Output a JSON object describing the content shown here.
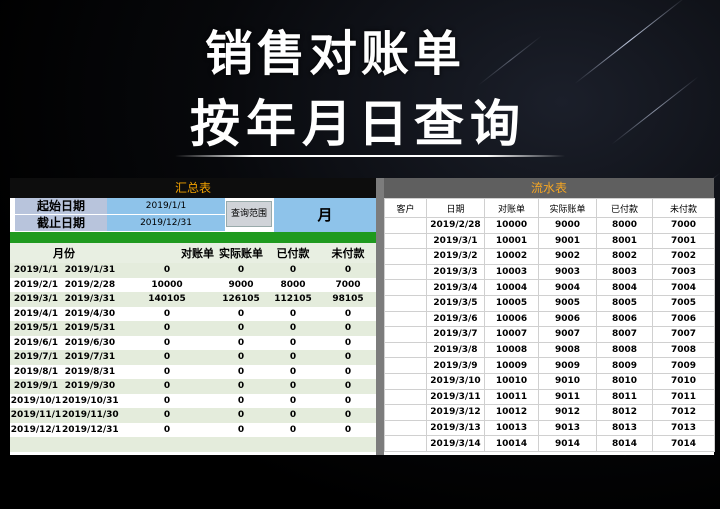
{
  "banner": {
    "title_line1": "销售对账单",
    "title_line2": "按年月日查询"
  },
  "summary": {
    "title": "汇总表",
    "start_label": "起始日期",
    "start_value": "2019/1/1",
    "end_label": "截止日期",
    "end_value": "2019/12/31",
    "query_button": "查询范围",
    "range_value": "月",
    "columns": [
      "月份",
      "对账单",
      "实际账单",
      "已付款",
      "未付款"
    ],
    "rows": [
      [
        "2019/1/1",
        "2019/1/31",
        "0",
        "0",
        "0",
        "0"
      ],
      [
        "2019/2/1",
        "2019/2/28",
        "10000",
        "9000",
        "8000",
        "7000"
      ],
      [
        "2019/3/1",
        "2019/3/31",
        "140105",
        "126105",
        "112105",
        "98105"
      ],
      [
        "2019/4/1",
        "2019/4/30",
        "0",
        "0",
        "0",
        "0"
      ],
      [
        "2019/5/1",
        "2019/5/31",
        "0",
        "0",
        "0",
        "0"
      ],
      [
        "2019/6/1",
        "2019/6/30",
        "0",
        "0",
        "0",
        "0"
      ],
      [
        "2019/7/1",
        "2019/7/31",
        "0",
        "0",
        "0",
        "0"
      ],
      [
        "2019/8/1",
        "2019/8/31",
        "0",
        "0",
        "0",
        "0"
      ],
      [
        "2019/9/1",
        "2019/9/30",
        "0",
        "0",
        "0",
        "0"
      ],
      [
        "2019/10/1",
        "2019/10/31",
        "0",
        "0",
        "0",
        "0"
      ],
      [
        "2019/11/1",
        "2019/11/30",
        "0",
        "0",
        "0",
        "0"
      ],
      [
        "2019/12/1",
        "2019/12/31",
        "0",
        "0",
        "0",
        "0"
      ]
    ]
  },
  "ledger": {
    "title": "流水表",
    "columns": [
      "客户",
      "日期",
      "对账单",
      "实际账单",
      "已付款",
      "未付款"
    ],
    "rows": [
      [
        "",
        "2019/2/28",
        "10000",
        "9000",
        "8000",
        "7000"
      ],
      [
        "",
        "2019/3/1",
        "10001",
        "9001",
        "8001",
        "7001"
      ],
      [
        "",
        "2019/3/2",
        "10002",
        "9002",
        "8002",
        "7002"
      ],
      [
        "",
        "2019/3/3",
        "10003",
        "9003",
        "8003",
        "7003"
      ],
      [
        "",
        "2019/3/4",
        "10004",
        "9004",
        "8004",
        "7004"
      ],
      [
        "",
        "2019/3/5",
        "10005",
        "9005",
        "8005",
        "7005"
      ],
      [
        "",
        "2019/3/6",
        "10006",
        "9006",
        "8006",
        "7006"
      ],
      [
        "",
        "2019/3/7",
        "10007",
        "9007",
        "8007",
        "7007"
      ],
      [
        "",
        "2019/3/8",
        "10008",
        "9008",
        "8008",
        "7008"
      ],
      [
        "",
        "2019/3/9",
        "10009",
        "9009",
        "8009",
        "7009"
      ],
      [
        "",
        "2019/3/10",
        "10010",
        "9010",
        "8010",
        "7010"
      ],
      [
        "",
        "2019/3/11",
        "10011",
        "9011",
        "8011",
        "7011"
      ],
      [
        "",
        "2019/3/12",
        "10012",
        "9012",
        "8012",
        "7012"
      ],
      [
        "",
        "2019/3/13",
        "10013",
        "9013",
        "8013",
        "7013"
      ],
      [
        "",
        "2019/3/14",
        "10014",
        "9014",
        "8014",
        "7014"
      ]
    ]
  }
}
